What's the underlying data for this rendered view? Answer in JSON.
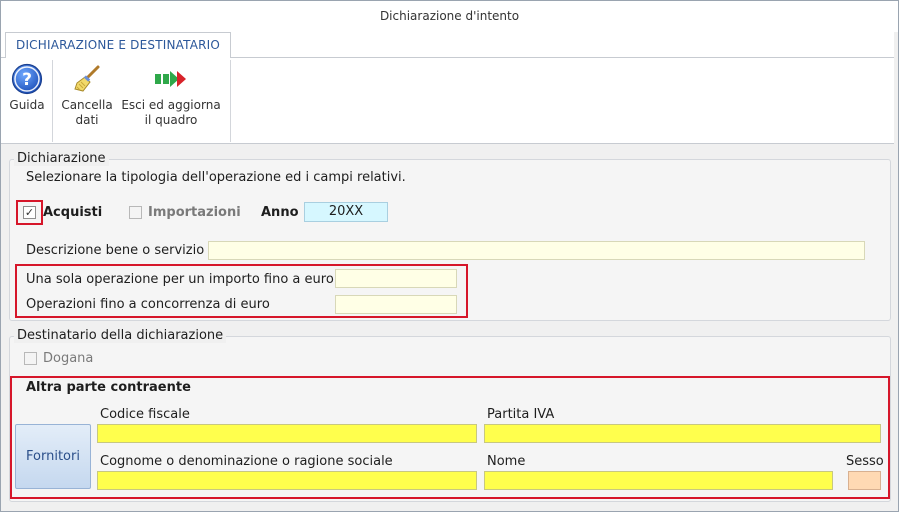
{
  "window": {
    "title": "Dichiarazione d'intento"
  },
  "ribbon": {
    "tab": "DICHIARAZIONE E DESTINATARIO",
    "buttons": {
      "guida": "Guida",
      "cancella_line1": "Cancella",
      "cancella_line2": "dati",
      "esci_line1": "Esci ed aggiorna",
      "esci_line2": "il quadro"
    }
  },
  "dichiarazione": {
    "title": "Dichiarazione",
    "instructions": "Selezionare la tipologia dell'operazione ed i campi relativi.",
    "acquisti": {
      "label": "Acquisti",
      "checked": true
    },
    "importazioni": {
      "label": "Importazioni",
      "checked": false
    },
    "anno_label": "Anno",
    "anno_value": "20XX",
    "descrizione_label": "Descrizione bene o servizio",
    "una_sola_label": "Una sola operazione per un importo fino a euro",
    "concorrenza_label": "Operazioni fino a concorrenza di euro"
  },
  "destinatario": {
    "title": "Destinatario della dichiarazione",
    "dogana_label": "Dogana",
    "altra_parte_title": "Altra parte contraente",
    "fornitori_button": "Fornitori",
    "codice_fiscale_label": "Codice fiscale",
    "partita_iva_label": "Partita IVA",
    "cognome_label": "Cognome o denominazione o ragione sociale",
    "nome_label": "Nome",
    "sesso_label": "Sesso"
  },
  "colors": {
    "highlight_red": "#d6162a",
    "required_yellow": "#ffff4d",
    "optional_cream": "#ffffe6",
    "anno_cyan": "#d6f7ff",
    "sesso_peach": "#ffd9b3",
    "tab_blue": "#2b579a"
  }
}
